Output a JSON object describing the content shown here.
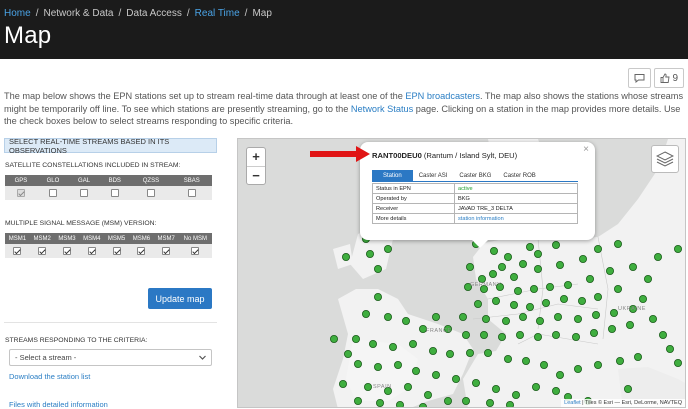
{
  "breadcrumb": [
    {
      "label": "Home",
      "link": true
    },
    {
      "label": "Network & Data",
      "link": false
    },
    {
      "label": "Data Access",
      "link": false
    },
    {
      "label": "Real Time",
      "link": true
    },
    {
      "label": "Map",
      "link": false
    }
  ],
  "page_title": "Map",
  "actions": {
    "comment_count": "9"
  },
  "intro": {
    "p1": "The map below shows the EPN stations set up to stream real-time data through at least one of the ",
    "link1": "EPN broadcasters",
    "p2": ". The map also shows the stations whose streams might be temporarily off line. To see which stations are presently streaming, go to the ",
    "link2": "Network Status",
    "p3": " page. Clicking on a station in the map provides more details. Use the check boxes below to select streams responding to specific criteria."
  },
  "panel": {
    "header": "Select real-time streams based in its observations",
    "constellations_title": "Satellite constellations included in stream:",
    "constellations": [
      {
        "label": "GPS",
        "checked": true,
        "disabled": true
      },
      {
        "label": "GLO",
        "checked": false,
        "disabled": false
      },
      {
        "label": "GAL",
        "checked": false,
        "disabled": false
      },
      {
        "label": "BDS",
        "checked": false,
        "disabled": false
      },
      {
        "label": "QZSS",
        "checked": false,
        "disabled": false
      },
      {
        "label": "SBAS",
        "checked": false,
        "disabled": false
      }
    ],
    "msm_title": "Multiple signal message (MSM) version:",
    "msm": [
      {
        "label": "MSM1",
        "checked": true
      },
      {
        "label": "MSM2",
        "checked": true
      },
      {
        "label": "MSM3",
        "checked": true
      },
      {
        "label": "MSM4",
        "checked": true
      },
      {
        "label": "MSM5",
        "checked": true
      },
      {
        "label": "MSM6",
        "checked": true
      },
      {
        "label": "MSM7",
        "checked": true
      },
      {
        "label": "No MSM",
        "checked": true
      }
    ],
    "update_button": "Update map",
    "streams_title": "Streams responding to the criteria:",
    "select_placeholder": "- Select a stream -",
    "download_link": "Download the station list",
    "files_link": "Files with detailed information"
  },
  "map": {
    "zoom_in": "+",
    "zoom_out": "−",
    "countries": [
      "GERMANY",
      "FRANCE",
      "UKRAINE",
      "SPAIN"
    ],
    "attribution_link": "Leaflet",
    "attribution_text": " | Tiles © Esri — Esri, DeLorme, NAVTEQ",
    "marker_color": "#3fae3f",
    "popup": {
      "station_id": "RANT00DEU0",
      "station_place": " (Rantum / Island Sylt, DEU)",
      "tabs": [
        "Station",
        "Caster ASI",
        "Caster BKG",
        "Caster ROB"
      ],
      "rows": [
        {
          "key": "Status in EPN",
          "value": "active"
        },
        {
          "key": "Operated by",
          "value": "BKG"
        },
        {
          "key": "Receiver",
          "value": "JAVAD TRE_3 DELTA"
        },
        {
          "key": "More details",
          "value": "station information"
        }
      ],
      "close": "×"
    }
  },
  "colors": {
    "header_bg": "#1b1b1b",
    "accent": "#2b78c4",
    "link": "#2a7ec4",
    "active_status": "#1f9e2f",
    "arrow": "#e01414"
  }
}
